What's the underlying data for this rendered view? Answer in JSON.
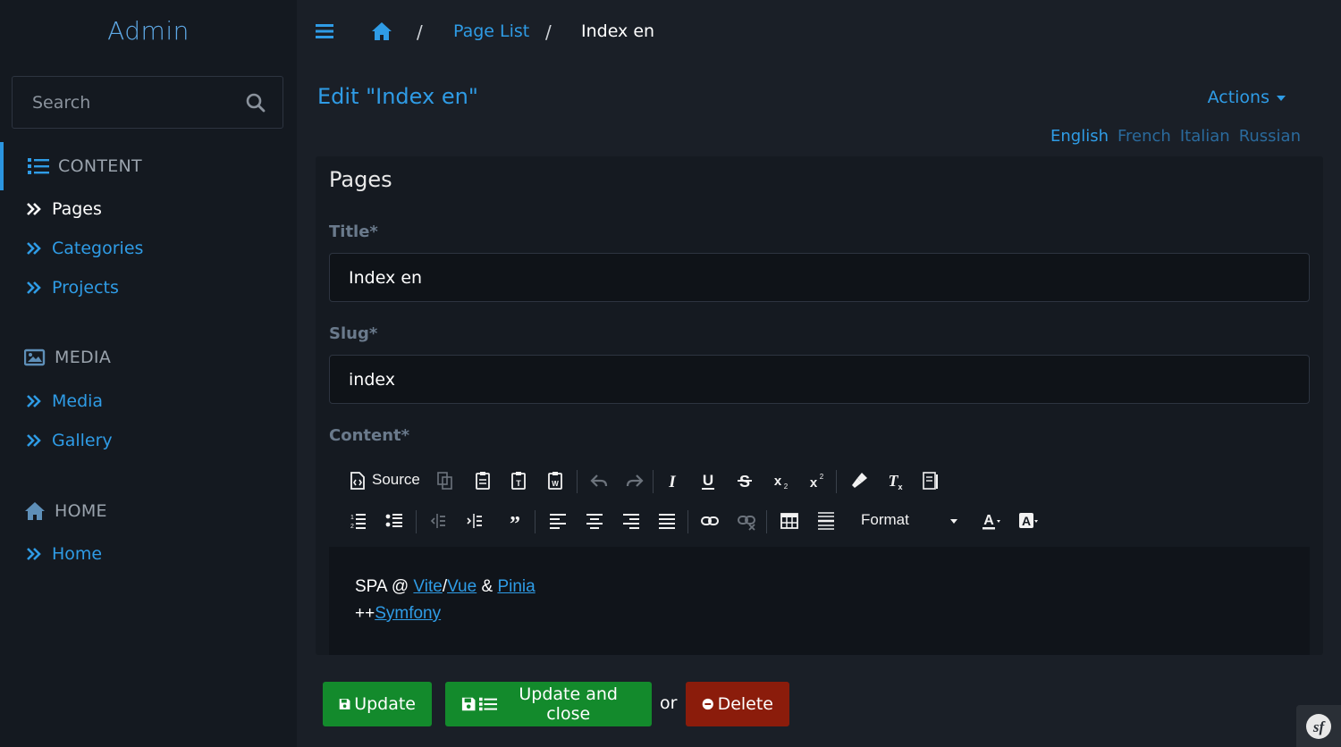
{
  "app": {
    "brand": "Admin"
  },
  "search": {
    "placeholder": "Search"
  },
  "sidebar": {
    "sections": [
      {
        "label": "CONTENT",
        "icon": "list-icon",
        "items": [
          {
            "label": "Pages"
          },
          {
            "label": "Categories"
          },
          {
            "label": "Projects"
          }
        ]
      },
      {
        "label": "MEDIA",
        "icon": "image-icon",
        "items": [
          {
            "label": "Media"
          },
          {
            "label": "Gallery"
          }
        ]
      },
      {
        "label": "HOME",
        "icon": "home-icon",
        "items": [
          {
            "label": "Home"
          }
        ]
      }
    ]
  },
  "breadcrumb": {
    "separator": "/",
    "link": "Page List",
    "current": "Index en"
  },
  "header": {
    "title": "Edit \"Index en\"",
    "actions_label": "Actions"
  },
  "languages": [
    {
      "label": "English"
    },
    {
      "label": "French"
    },
    {
      "label": "Italian"
    },
    {
      "label": "Russian"
    }
  ],
  "form": {
    "panel_title": "Pages",
    "title_label": "Title*",
    "title_value": "Index en",
    "slug_label": "Slug*",
    "slug_value": "index",
    "content_label": "Content*"
  },
  "editor_toolbar": {
    "source_label": "Source",
    "format_label": "Format"
  },
  "editor_content": {
    "line1_prefix": "SPA @ ",
    "link_vite": "Vite",
    "slash": "/",
    "link_vue": "Vue",
    "amp": " & ",
    "link_pinia": "Pinia",
    "line2_prefix": "++",
    "link_symfony": "Symfony"
  },
  "footer": {
    "update_label": "Update",
    "update_close_label": "Update and close",
    "or_text": "or",
    "delete_label": "Delete"
  },
  "colors": {
    "accent": "#2f9ce6",
    "success": "#138a2c",
    "danger": "#8b1c0b",
    "sidebar_bg": "#141920",
    "main_bg": "#1a1f27"
  }
}
